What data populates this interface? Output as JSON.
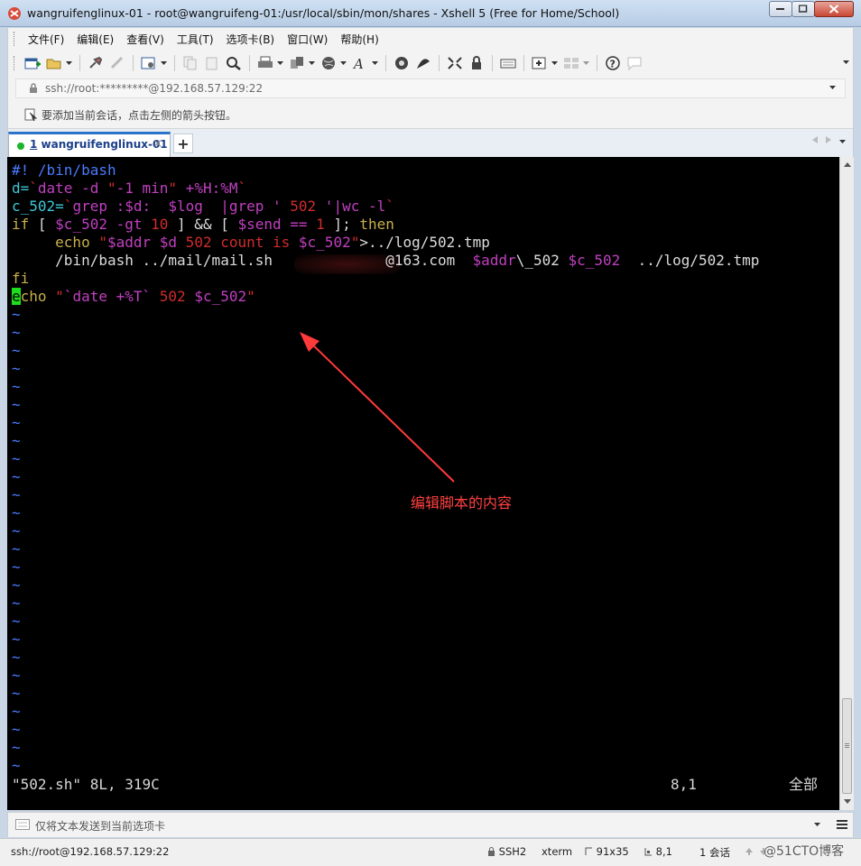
{
  "window": {
    "title": "wangruifenglinux-01 - root@wangruifeng-01:/usr/local/sbin/mon/shares - Xshell 5 (Free for Home/School)"
  },
  "menu": {
    "items": [
      "文件(F)",
      "编辑(E)",
      "查看(V)",
      "工具(T)",
      "选项卡(B)",
      "窗口(W)",
      "帮助(H)"
    ]
  },
  "toolbar": {
    "icons": [
      "new-session-icon",
      "open-folder-icon",
      "reconnect-icon",
      "disconnect-icon",
      "properties-icon",
      "copy-icon",
      "paste-icon",
      "find-icon",
      "print-icon",
      "transfer-icon",
      "globe-icon",
      "font-icon",
      "xftp-icon",
      "xagent-icon",
      "fullscreen-icon",
      "lock-icon",
      "keyboard-icon",
      "add-icon",
      "layout-icon",
      "help-icon",
      "chat-icon"
    ]
  },
  "address": {
    "text": "ssh://root:*********@192.168.57.129:22"
  },
  "hint": {
    "text": "要添加当前会话，点击左侧的箭头按钮。"
  },
  "tab": {
    "number": "1",
    "label": " wangruifenglinux-01",
    "close": "×",
    "add": "+"
  },
  "terminal": {
    "lines": [
      [
        {
          "t": "#! /bin/bash",
          "c": "c-blue"
        }
      ],
      [
        {
          "t": "d=",
          "c": "c-cyan"
        },
        {
          "t": "`",
          "c": "c-red"
        },
        {
          "t": "date -d ",
          "c": "c-mag"
        },
        {
          "t": "\"",
          "c": "c-red"
        },
        {
          "t": "-1 min",
          "c": "c-mag"
        },
        {
          "t": "\"",
          "c": "c-red"
        },
        {
          "t": " +%H:%M",
          "c": "c-mag"
        },
        {
          "t": "`",
          "c": "c-red"
        }
      ],
      [
        {
          "t": "c_502=",
          "c": "c-cyan"
        },
        {
          "t": "`",
          "c": "c-red"
        },
        {
          "t": "grep :",
          "c": "c-mag"
        },
        {
          "t": "$d",
          "c": "c-mag"
        },
        {
          "t": ":  ",
          "c": "c-mag"
        },
        {
          "t": "$log",
          "c": "c-mag"
        },
        {
          "t": "  |grep ",
          "c": "c-mag"
        },
        {
          "t": "' ",
          "c": "c-mag"
        },
        {
          "t": "502",
          "c": "c-red"
        },
        {
          "t": " '",
          "c": "c-mag"
        },
        {
          "t": "|wc -l",
          "c": "c-mag"
        },
        {
          "t": "`",
          "c": "c-red"
        }
      ],
      [
        {
          "t": "if",
          "c": "c-yel"
        },
        {
          "t": " [ ",
          "c": "c-wht"
        },
        {
          "t": "$c_502",
          "c": "c-mag"
        },
        {
          "t": " -gt ",
          "c": "c-mag"
        },
        {
          "t": "10",
          "c": "c-red"
        },
        {
          "t": " ] && [ ",
          "c": "c-wht"
        },
        {
          "t": "$send",
          "c": "c-mag"
        },
        {
          "t": " == ",
          "c": "c-mag"
        },
        {
          "t": "1",
          "c": "c-red"
        },
        {
          "t": " ]; ",
          "c": "c-wht"
        },
        {
          "t": "then",
          "c": "c-yel"
        }
      ],
      [
        {
          "t": "     echo ",
          "c": "c-yel"
        },
        {
          "t": "\"",
          "c": "c-red"
        },
        {
          "t": "$addr",
          "c": "c-mag"
        },
        {
          "t": " ",
          "c": "c-red"
        },
        {
          "t": "$d",
          "c": "c-mag"
        },
        {
          "t": " 502 count is ",
          "c": "c-red"
        },
        {
          "t": "$c_502",
          "c": "c-mag"
        },
        {
          "t": "\"",
          "c": "c-red"
        },
        {
          "t": ">../log/502.tmp",
          "c": "c-wht"
        }
      ],
      [
        {
          "t": "     /bin/bash ../mail/mail.sh ",
          "c": "c-wht"
        },
        {
          "t": "            ",
          "c": "c-wht"
        },
        {
          "t": "@163.com  ",
          "c": "c-wht"
        },
        {
          "t": "$addr",
          "c": "c-mag"
        },
        {
          "t": "\\_502 ",
          "c": "c-wht"
        },
        {
          "t": "$c_502",
          "c": "c-mag"
        },
        {
          "t": "  ../log/502.tmp",
          "c": "c-wht"
        }
      ],
      [
        {
          "t": "fi",
          "c": "c-yel"
        }
      ],
      [
        {
          "t": "e",
          "c": "cursor"
        },
        {
          "t": "cho ",
          "c": "c-yel"
        },
        {
          "t": "\"",
          "c": "c-red"
        },
        {
          "t": "`date +%T`",
          "c": "c-mag"
        },
        {
          "t": " 502 ",
          "c": "c-red"
        },
        {
          "t": "$c_502",
          "c": "c-mag"
        },
        {
          "t": "\"",
          "c": "c-red"
        }
      ]
    ],
    "tilde_count": 26,
    "annotation": "编辑脚本的内容",
    "status_file": "\"502.sh\" 8L, 319C",
    "status_pos": "8,1",
    "status_all": "全部"
  },
  "sendbar": {
    "text": "仅将文本发送到当前选项卡"
  },
  "statusbar": {
    "host": "ssh://root@192.168.57.129:22",
    "protocol": "SSH2",
    "term": "xterm",
    "size": "91x35",
    "position": "8,1",
    "sessions": "1 会话",
    "watermark": "@51CTO博客"
  }
}
